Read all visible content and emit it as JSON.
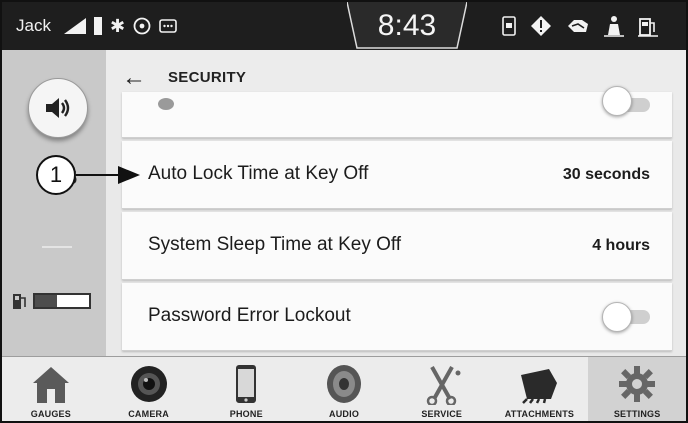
{
  "status_bar": {
    "user": "Jack",
    "time": "8:43",
    "left_icons": [
      "signal-icon",
      "battery-icon",
      "bluetooth-icon",
      "wifi-hotspot-icon",
      "message-icon"
    ],
    "right_icons": [
      "phone-card-icon",
      "warning-icon",
      "engine-light-icon",
      "seatbelt-icon",
      "fuel-pump-icon"
    ]
  },
  "rail": {
    "volume_icon": "speaker-icon",
    "partial_value": ".5",
    "fuel_icon": "fuel-pump-icon",
    "fuel_level": 0.4
  },
  "header": {
    "back_icon": "back-arrow-icon",
    "title": "SECURITY"
  },
  "settings": [
    {
      "label": "Auto Lock Time at Key Off",
      "value": "30 seconds"
    },
    {
      "label": "System Sleep Time at Key Off",
      "value": "4 hours"
    },
    {
      "label": "Password Error Lockout",
      "toggle": false
    }
  ],
  "callout": {
    "number": "1"
  },
  "bottom_nav": [
    {
      "label": "GAUGES",
      "icon": "home-icon"
    },
    {
      "label": "CAMERA",
      "icon": "camera-icon"
    },
    {
      "label": "PHONE",
      "icon": "phone-icon"
    },
    {
      "label": "AUDIO",
      "icon": "speaker-icon"
    },
    {
      "label": "SERVICE",
      "icon": "wrench-icon"
    },
    {
      "label": "ATTACHMENTS",
      "icon": "bucket-icon"
    },
    {
      "label": "SETTINGS",
      "icon": "gear-icon",
      "active": true
    }
  ]
}
